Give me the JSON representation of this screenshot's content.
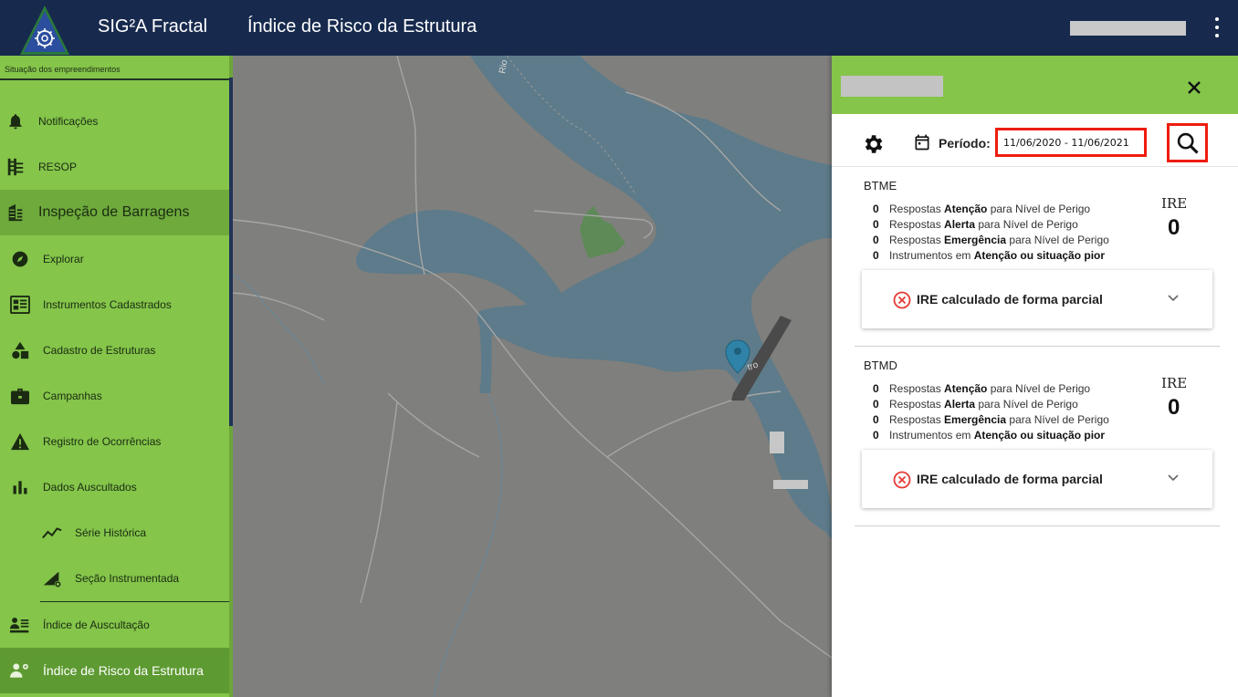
{
  "header": {
    "app_title": "SIG²A Fractal",
    "page_title": "Índice de Risco da Estrutura"
  },
  "sidebar": {
    "caption": "Situação dos empreendimentos",
    "items": [
      {
        "label": "Notificações",
        "icon": "bell-icon"
      },
      {
        "label": "RESOP",
        "icon": "resop-icon"
      },
      {
        "label": "Inspeção de Barragens",
        "icon": "dam-icon"
      },
      {
        "label": "Explorar",
        "icon": "compass-icon"
      },
      {
        "label": "Instrumentos Cadastrados",
        "icon": "instruments-icon"
      },
      {
        "label": "Cadastro de Estruturas",
        "icon": "shapes-icon"
      },
      {
        "label": "Campanhas",
        "icon": "briefcase-icon"
      },
      {
        "label": "Registro de Ocorrências",
        "icon": "warning-icon"
      },
      {
        "label": "Dados Auscultados",
        "icon": "bar-chart-icon"
      },
      {
        "label": "Série Histórica",
        "icon": "line-chart-icon"
      },
      {
        "label": "Seção Instrumentada",
        "icon": "section-icon"
      },
      {
        "label": "Índice de Auscultação",
        "icon": "people-list-icon"
      },
      {
        "label": "Índice de Risco da Estrutura",
        "icon": "people-gear-icon"
      }
    ]
  },
  "panel": {
    "period_label": "Período:",
    "period_value": "11/06/2020 - 11/06/2021",
    "structures": [
      {
        "name": "BTME",
        "ire_label": "IRE",
        "ire_value": "0",
        "rows": [
          {
            "count": "0",
            "pre": "Respostas ",
            "bold": "Atenção",
            "post": " para Nível de Perigo"
          },
          {
            "count": "0",
            "pre": "Respostas ",
            "bold": "Alerta",
            "post": " para Nível de Perigo"
          },
          {
            "count": "0",
            "pre": "Respostas ",
            "bold": "Emergência",
            "post": " para Nível de Perigo"
          },
          {
            "count": "0",
            "pre": "Instrumentos em ",
            "bold": "Atenção ou situação pior",
            "post": ""
          }
        ],
        "accordion_text": "IRE calculado de forma parcial"
      },
      {
        "name": "BTMD",
        "ire_label": "IRE",
        "ire_value": "0",
        "rows": [
          {
            "count": "0",
            "pre": "Respostas ",
            "bold": "Atenção",
            "post": " para Nível de Perigo"
          },
          {
            "count": "0",
            "pre": "Respostas ",
            "bold": "Alerta",
            "post": " para Nível de Perigo"
          },
          {
            "count": "0",
            "pre": "Respostas ",
            "bold": "Emergência",
            "post": " para Nível de Perigo"
          },
          {
            "count": "0",
            "pre": "Instrumentos em ",
            "bold": "Atenção ou situação pior",
            "post": ""
          }
        ],
        "accordion_text": "IRE calculado de forma parcial"
      }
    ]
  },
  "map": {
    "road_label": "Rio",
    "road_label_2": "tro"
  },
  "colors": {
    "header": "#172a4e",
    "sidebar": "#84c54a",
    "sidebar_active": "#5e9a32",
    "highlight": "#ee1c0e",
    "water": "#5b7a89"
  }
}
